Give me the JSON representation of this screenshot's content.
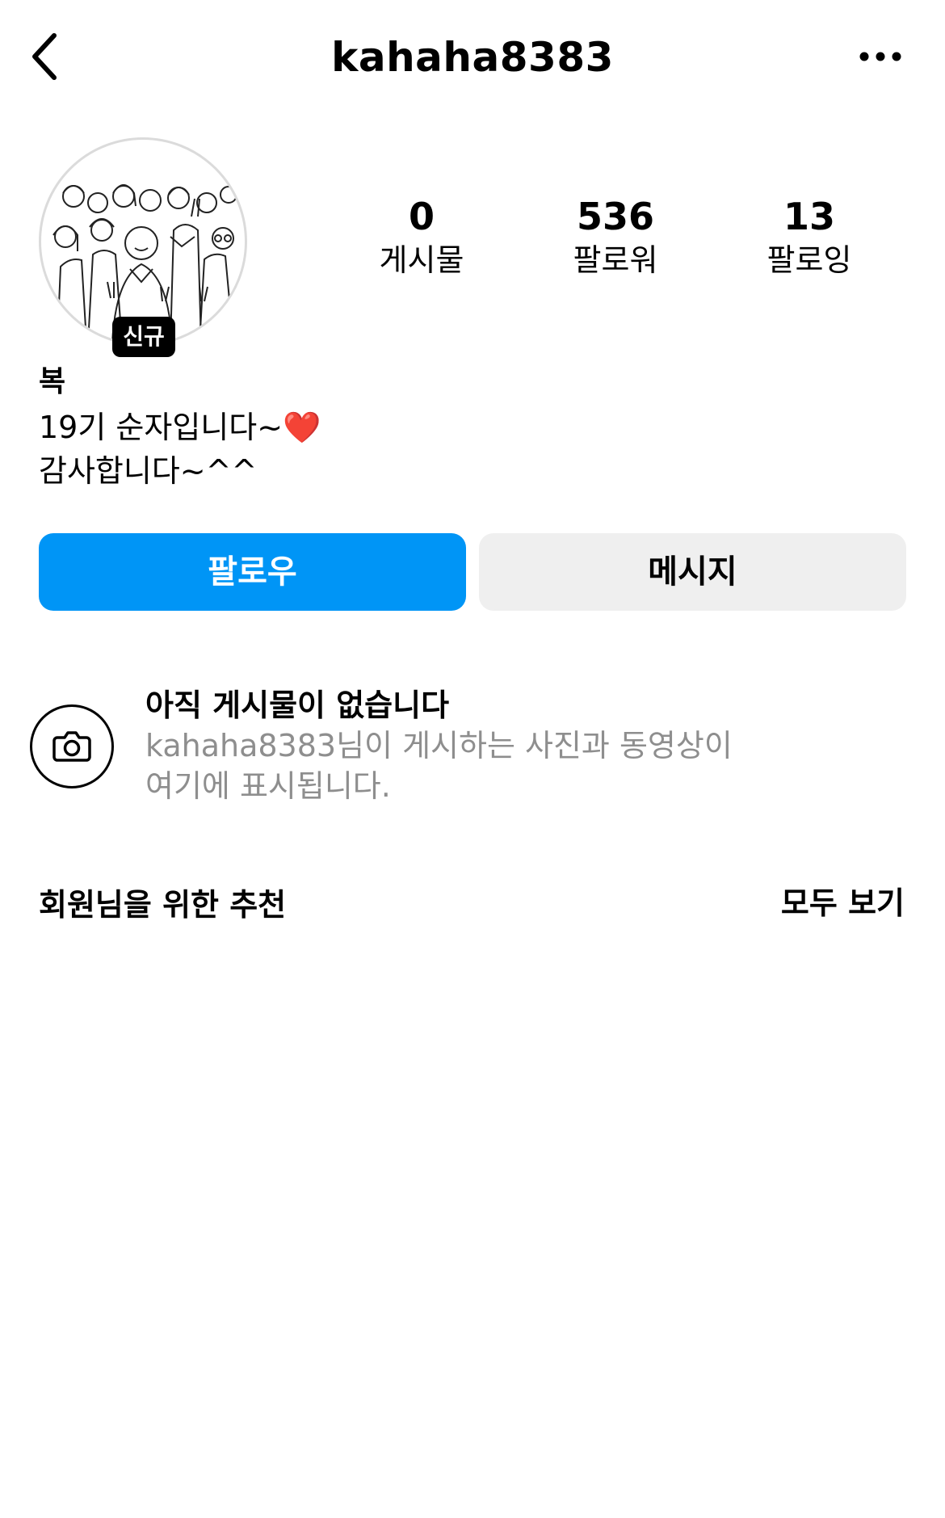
{
  "header": {
    "username": "kahaha8383"
  },
  "profile": {
    "new_badge": "신규",
    "stats": [
      {
        "value": "0",
        "label": "게시물"
      },
      {
        "value": "536",
        "label": "팔로워"
      },
      {
        "value": "13",
        "label": "팔로잉"
      }
    ],
    "name": "복",
    "bio_line1": "19기 순자입니다~",
    "bio_line1_emoji": "❤️",
    "bio_line2": "감사합니다~^^"
  },
  "actions": {
    "follow_label": "팔로우",
    "message_label": "메시지"
  },
  "empty_posts": {
    "title": "아직 게시물이 없습니다",
    "desc_line1": "kahaha8383님이 게시하는 사진과 동영상이",
    "desc_line2": "여기에 표시됩니다."
  },
  "suggestions": {
    "title": "회원님을 위한 추천",
    "see_all": "모두 보기"
  },
  "colors": {
    "follow_button": "#0095f6",
    "message_button": "#efefef",
    "muted_text": "#8e8e8e",
    "heart": "#e0245e"
  }
}
